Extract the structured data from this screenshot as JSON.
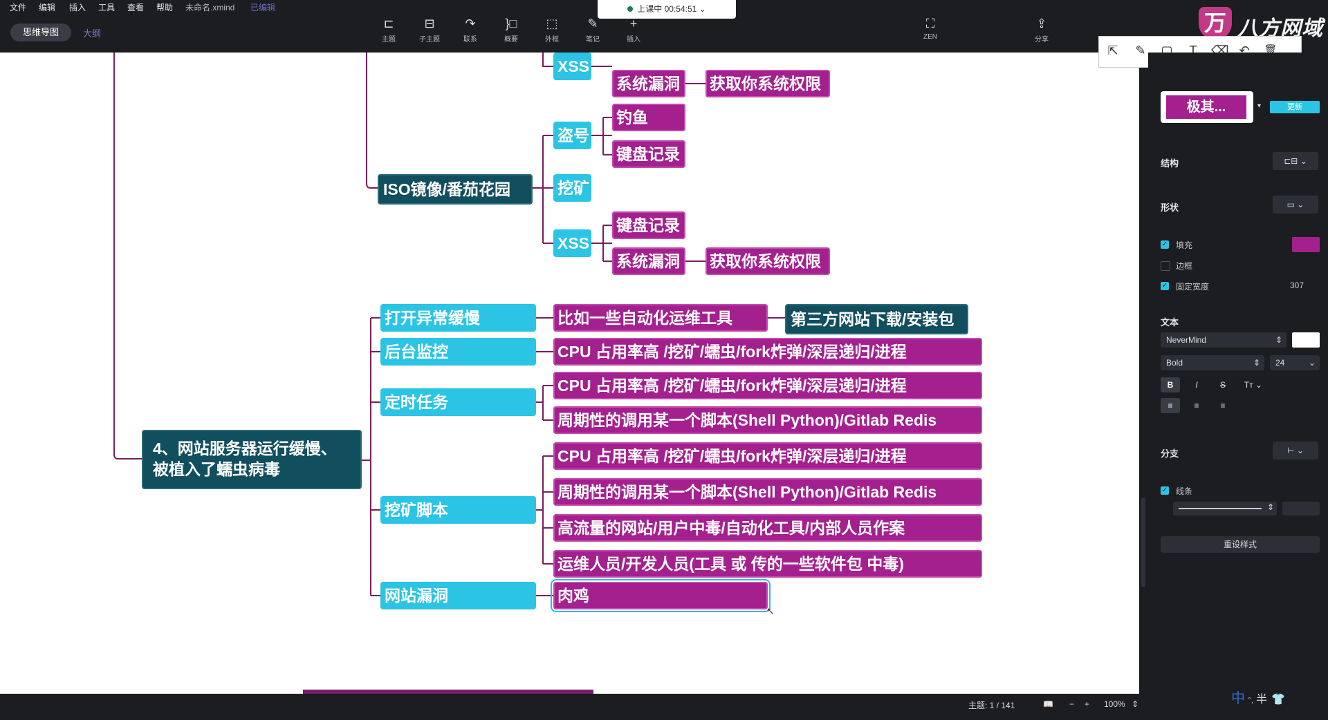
{
  "menu": [
    "文件",
    "编辑",
    "插入",
    "工具",
    "查看",
    "帮助"
  ],
  "file_name": "未命名.xmind",
  "save_status": "已编辑",
  "view_tabs": {
    "mindmap": "思维导图",
    "outline": "大纲"
  },
  "toolbar": [
    {
      "icon": "topic-icon",
      "glyph": "⊏",
      "label": "主题"
    },
    {
      "icon": "subtopic-icon",
      "glyph": "⊟",
      "label": "子主题"
    },
    {
      "icon": "relationship-icon",
      "glyph": "↷",
      "label": "联系"
    },
    {
      "icon": "summary-icon",
      "glyph": "}□",
      "label": "概要"
    },
    {
      "icon": "boundary-icon",
      "glyph": "⬚",
      "label": "外框"
    },
    {
      "icon": "note-icon",
      "glyph": "✎",
      "label": "笔记"
    },
    {
      "icon": "insert-icon",
      "glyph": "+",
      "label": "插入"
    }
  ],
  "toolbar_right": [
    {
      "icon": "zen-icon",
      "glyph": "⛶",
      "label": "ZEN"
    },
    {
      "icon": "share-icon",
      "glyph": "⇪",
      "label": "分享"
    }
  ],
  "recording": "上课中 00:54:51",
  "brand": {
    "logo_letter": "万",
    "name": "八方网域"
  },
  "annotation_tools": [
    "select-arrow-icon",
    "pen-icon",
    "rectangle-icon",
    "text-icon",
    "eraser-icon",
    "undo-icon",
    "trash-icon"
  ],
  "annotation_glyphs": [
    "⇱",
    "✎",
    "▢",
    "T",
    "⌫",
    "↶",
    "🗑"
  ],
  "nodes": {
    "xss_top": "XSS",
    "vuln1": "系统漏洞",
    "priv1": "获取你系统权限",
    "steal": "盗号",
    "phish": "钓鱼",
    "keylog1": "键盘记录",
    "iso": "ISO镜像/番茄花园",
    "mining": "挖矿",
    "xss2": "XSS",
    "keylog2": "键盘记录",
    "vuln2": "系统漏洞",
    "priv2": "获取你系统权限",
    "main_topic_line1": "4、网站服务器运行缓慢、",
    "main_topic_line2": "被植入了蠕虫病毒",
    "slow_open": "打开异常缓慢",
    "auto_tools": "比如一些自动化运维工具",
    "third_party": "第三方网站下载/安装包",
    "monitor": "后台监控",
    "cpu1": "CPU 占用率高 /挖矿/蠕虫/fork炸弹/深层递归/进程",
    "cron": "定时任务",
    "cpu2": "CPU 占用率高 /挖矿/蠕虫/fork炸弹/深层递归/进程",
    "script1": "周期性的调用某一个脚本(Shell Python)/Gitlab Redis",
    "cpu3": "CPU 占用率高 /挖矿/蠕虫/fork炸弹/深层递归/进程",
    "mining_script": "挖矿脚本",
    "script2": "周期性的调用某一个脚本(Shell Python)/Gitlab Redis",
    "traffic": "高流量的网站/用户中毒/自动化工具/内部人员作案",
    "ops": "运维人员/开发人员(工具 或 传的一些软件包 中毒)",
    "web_vuln": "网站漏洞",
    "zombie": "肉鸡"
  },
  "panel": {
    "style_name": "极其...",
    "update_button": "更新",
    "structure": "结构",
    "shape": "形状",
    "fill": "填充",
    "border": "边框",
    "fixed_width": "固定宽度",
    "fixed_width_value": "307",
    "text": "文本",
    "font": "NeverMind",
    "weight": "Bold",
    "size": "24",
    "branch": "分支",
    "line": "线条",
    "reset_style": "重设样式",
    "fill_color": "#a4208f",
    "text_color": "#ffffff"
  },
  "status": {
    "topics": "主题: 1 / 141",
    "zoom": "100%"
  },
  "ime": {
    "lang": "中",
    "mode": "半"
  }
}
